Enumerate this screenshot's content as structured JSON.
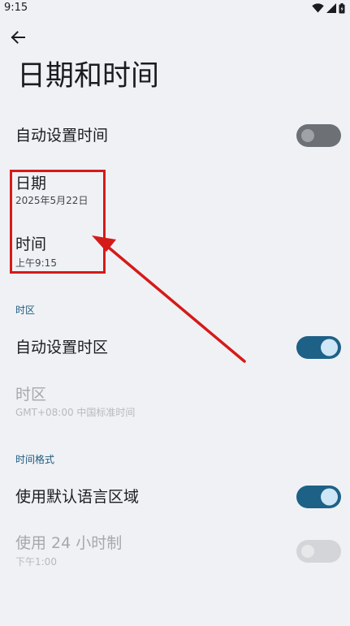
{
  "status_bar": {
    "time": "9:15"
  },
  "header": {
    "title": "日期和时间"
  },
  "settings": {
    "auto_time": {
      "label": "自动设置时间",
      "enabled": false
    },
    "date": {
      "label": "日期",
      "value": "2025年5月22日"
    },
    "time": {
      "label": "时间",
      "value": "上午9:15"
    }
  },
  "timezone_section": {
    "header": "时区",
    "auto_timezone": {
      "label": "自动设置时区",
      "enabled": true
    },
    "timezone": {
      "label": "时区",
      "value": "GMT+08:00 中国标准时间"
    }
  },
  "format_section": {
    "header": "时间格式",
    "use_locale_default": {
      "label": "使用默认语言区域",
      "enabled": true
    },
    "use_24_hour": {
      "label": "使用 24 小时制",
      "value": "下午1:00",
      "enabled": false
    }
  },
  "colors": {
    "background": "#eff1f4",
    "accent": "#1d6187",
    "section_header": "#1d5a82",
    "annotation": "#d51a1a"
  },
  "icons": {
    "back": "arrow-back-icon",
    "wifi": "wifi-icon",
    "signal": "signal-icon",
    "battery": "battery-icon"
  }
}
